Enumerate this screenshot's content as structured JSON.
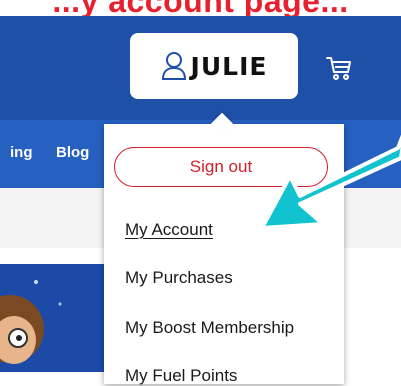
{
  "headline": "...y account page...",
  "header": {
    "account_name": "JULIE",
    "account_icon": "user-icon",
    "cart_icon": "cart-icon"
  },
  "nav": {
    "items": [
      "ing",
      "Blog"
    ]
  },
  "dropdown": {
    "sign_out_label": "Sign out",
    "items": [
      {
        "label": "My Account"
      },
      {
        "label": "My Purchases"
      },
      {
        "label": "My Boost Membership"
      },
      {
        "label": "My Fuel Points"
      }
    ]
  },
  "colors": {
    "header_blue": "#1e50a7",
    "accent_red": "#d0202a",
    "annotation_teal": "#10c3cf"
  }
}
